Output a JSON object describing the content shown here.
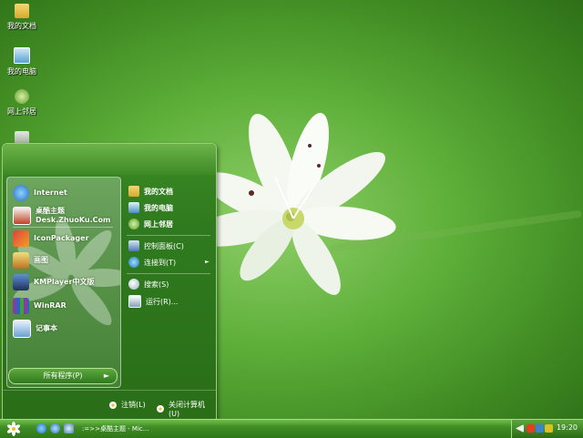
{
  "desktop": {
    "icons": [
      {
        "label": "我的文档",
        "icon": "folder-icon"
      },
      {
        "label": "我的电脑",
        "icon": "computer-icon"
      },
      {
        "label": "网上邻居",
        "icon": "network-icon"
      },
      {
        "label": "",
        "icon": "recycle-bin-icon"
      }
    ]
  },
  "start_menu": {
    "pinned": [
      {
        "label": "Internet",
        "sub": "",
        "icon": "internet-explorer-icon"
      },
      {
        "label": "桌酷主题",
        "sub": "Desk.ZhuoKu.Com",
        "icon": "theme-icon"
      },
      {
        "label": "IconPackager",
        "sub": "",
        "icon": "iconpackager-icon"
      },
      {
        "label": "画图",
        "sub": "",
        "icon": "paint-icon"
      },
      {
        "label": "KMPlayer中文版",
        "sub": "",
        "icon": "kmplayer-icon"
      },
      {
        "label": "WinRAR",
        "sub": "",
        "icon": "winrar-icon"
      },
      {
        "label": "记事本",
        "sub": "",
        "icon": "notepad-icon"
      }
    ],
    "all_programs": "所有程序(P)",
    "right_items": [
      {
        "label": "我的文档",
        "icon": "folder-icon"
      },
      {
        "label": "我的电脑",
        "icon": "computer-icon"
      },
      {
        "label": "网上邻居",
        "icon": "network-icon"
      },
      {
        "label": "控制面板(C)",
        "icon": "control-panel-icon"
      },
      {
        "label": "连接到(T)",
        "icon": "connect-icon"
      },
      {
        "label": "搜索(S)",
        "icon": "search-icon"
      },
      {
        "label": "运行(R)...",
        "icon": "run-icon"
      }
    ],
    "logoff": "注销(L)",
    "shutdown": "关闭计算机(U)"
  },
  "taskbar": {
    "task_label": ":=>>桌酷主题 - Mic...",
    "clock": "19:20"
  },
  "colors": {
    "accent": "#3f8d24",
    "highlight": "#a7dc85"
  }
}
